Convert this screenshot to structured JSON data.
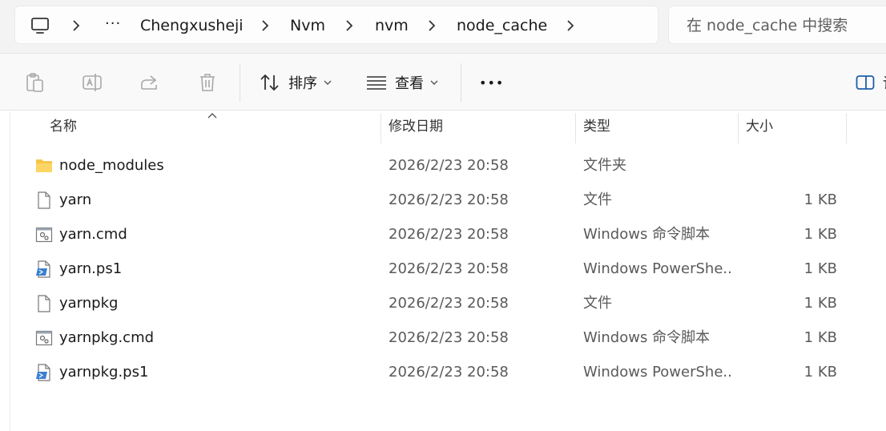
{
  "address_bar": {
    "pc_icon": "computer-icon",
    "overflow": "···",
    "breadcrumbs": [
      "Chengxusheji",
      "Nvm",
      "nvm",
      "node_cache"
    ]
  },
  "search": {
    "placeholder": "在 node_cache 中搜索"
  },
  "toolbar": {
    "icons": [
      "paste-icon",
      "rename-icon",
      "share-icon",
      "delete-icon"
    ],
    "sort_label": "排序",
    "view_label": "查看",
    "more": "•••",
    "right_clip_label": "详"
  },
  "columns": {
    "name": "名称",
    "modified": "修改日期",
    "type": "类型",
    "size": "大小"
  },
  "files": [
    {
      "icon": "folder-icon",
      "name": "node_modules",
      "modified": "2026/2/23 20:58",
      "type": "文件夹",
      "size": ""
    },
    {
      "icon": "file-icon",
      "name": "yarn",
      "modified": "2026/2/23 20:58",
      "type": "文件",
      "size": "1 KB"
    },
    {
      "icon": "cmd-file-icon",
      "name": "yarn.cmd",
      "modified": "2026/2/23 20:58",
      "type": "Windows 命令脚本",
      "size": "1 KB"
    },
    {
      "icon": "ps1-file-icon",
      "name": "yarn.ps1",
      "modified": "2026/2/23 20:58",
      "type": "Windows PowerShe...",
      "size": "1 KB"
    },
    {
      "icon": "file-icon",
      "name": "yarnpkg",
      "modified": "2026/2/23 20:58",
      "type": "文件",
      "size": "1 KB"
    },
    {
      "icon": "cmd-file-icon",
      "name": "yarnpkg.cmd",
      "modified": "2026/2/23 20:58",
      "type": "Windows 命令脚本",
      "size": "1 KB"
    },
    {
      "icon": "ps1-file-icon",
      "name": "yarnpkg.ps1",
      "modified": "2026/2/23 20:58",
      "type": "Windows PowerShe...",
      "size": "1 KB"
    }
  ]
}
